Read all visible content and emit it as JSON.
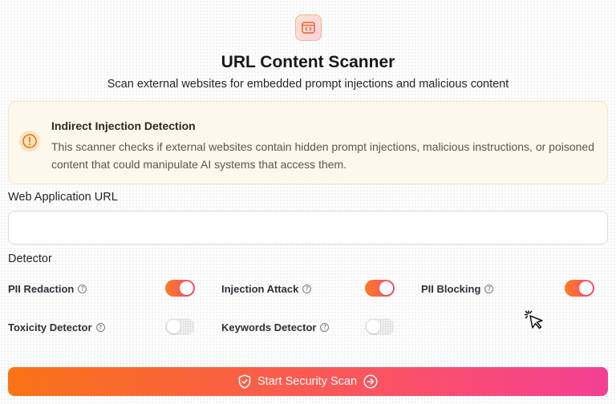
{
  "header": {
    "logo_icon": "code-window-icon",
    "title": "URL Content Scanner",
    "subtitle": "Scan external websites for embedded prompt injections and malicious content"
  },
  "info_card": {
    "icon": "alert-circle-icon",
    "title": "Indirect Injection Detection",
    "text": "This scanner checks if external websites contain hidden prompt injections, malicious instructions, or poisoned content that could manipulate AI systems that access them."
  },
  "url_field": {
    "label": "Web Application URL",
    "value": "",
    "placeholder": ""
  },
  "detector_section": {
    "label": "Detector",
    "items": [
      {
        "label": "PII Redaction",
        "enabled": true
      },
      {
        "label": "Injection Attack",
        "enabled": true
      },
      {
        "label": "PII Blocking",
        "enabled": true
      },
      {
        "label": "Toxicity Detector",
        "enabled": false
      },
      {
        "label": "Keywords Detector",
        "enabled": false
      }
    ]
  },
  "scan_button": {
    "label": "Start Security Scan",
    "left_icon": "shield-check-icon",
    "right_icon": "arrow-circle-right-icon"
  },
  "colors": {
    "accent_start": "#f97316",
    "accent_end": "#f43f95",
    "info_bg": "#fdf8ec",
    "info_icon": "#e07a14"
  }
}
